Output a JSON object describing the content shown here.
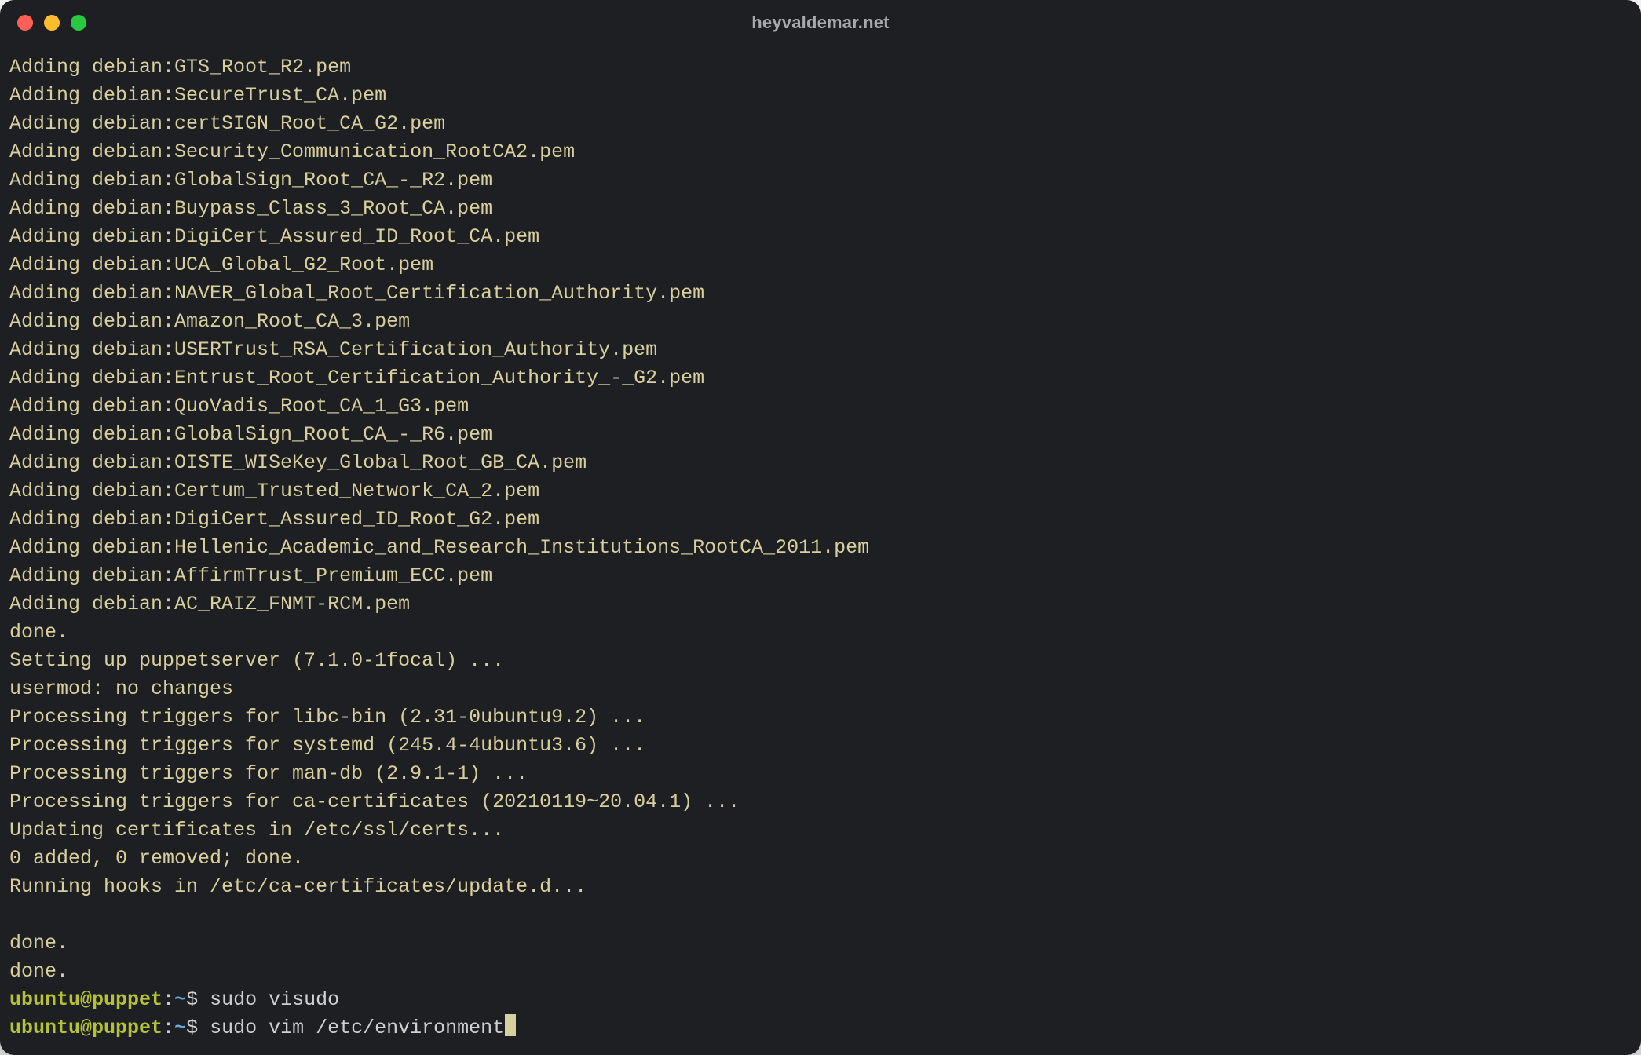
{
  "window": {
    "title": "heyvaldemar.net"
  },
  "output": [
    "Adding debian:GTS_Root_R2.pem",
    "Adding debian:SecureTrust_CA.pem",
    "Adding debian:certSIGN_Root_CA_G2.pem",
    "Adding debian:Security_Communication_RootCA2.pem",
    "Adding debian:GlobalSign_Root_CA_-_R2.pem",
    "Adding debian:Buypass_Class_3_Root_CA.pem",
    "Adding debian:DigiCert_Assured_ID_Root_CA.pem",
    "Adding debian:UCA_Global_G2_Root.pem",
    "Adding debian:NAVER_Global_Root_Certification_Authority.pem",
    "Adding debian:Amazon_Root_CA_3.pem",
    "Adding debian:USERTrust_RSA_Certification_Authority.pem",
    "Adding debian:Entrust_Root_Certification_Authority_-_G2.pem",
    "Adding debian:QuoVadis_Root_CA_1_G3.pem",
    "Adding debian:GlobalSign_Root_CA_-_R6.pem",
    "Adding debian:OISTE_WISeKey_Global_Root_GB_CA.pem",
    "Adding debian:Certum_Trusted_Network_CA_2.pem",
    "Adding debian:DigiCert_Assured_ID_Root_G2.pem",
    "Adding debian:Hellenic_Academic_and_Research_Institutions_RootCA_2011.pem",
    "Adding debian:AffirmTrust_Premium_ECC.pem",
    "Adding debian:AC_RAIZ_FNMT-RCM.pem",
    "done.",
    "Setting up puppetserver (7.1.0-1focal) ...",
    "usermod: no changes",
    "Processing triggers for libc-bin (2.31-0ubuntu9.2) ...",
    "Processing triggers for systemd (245.4-4ubuntu3.6) ...",
    "Processing triggers for man-db (2.9.1-1) ...",
    "Processing triggers for ca-certificates (20210119~20.04.1) ...",
    "Updating certificates in /etc/ssl/certs...",
    "0 added, 0 removed; done.",
    "Running hooks in /etc/ca-certificates/update.d...",
    "",
    "done.",
    "done."
  ],
  "prompts": [
    {
      "user": "ubuntu",
      "host": "puppet",
      "cwd": "~",
      "symbol": "$",
      "command": "sudo visudo",
      "cursor": false
    },
    {
      "user": "ubuntu",
      "host": "puppet",
      "cwd": "~",
      "symbol": "$",
      "command": "sudo vim /etc/environment",
      "cursor": true
    }
  ]
}
